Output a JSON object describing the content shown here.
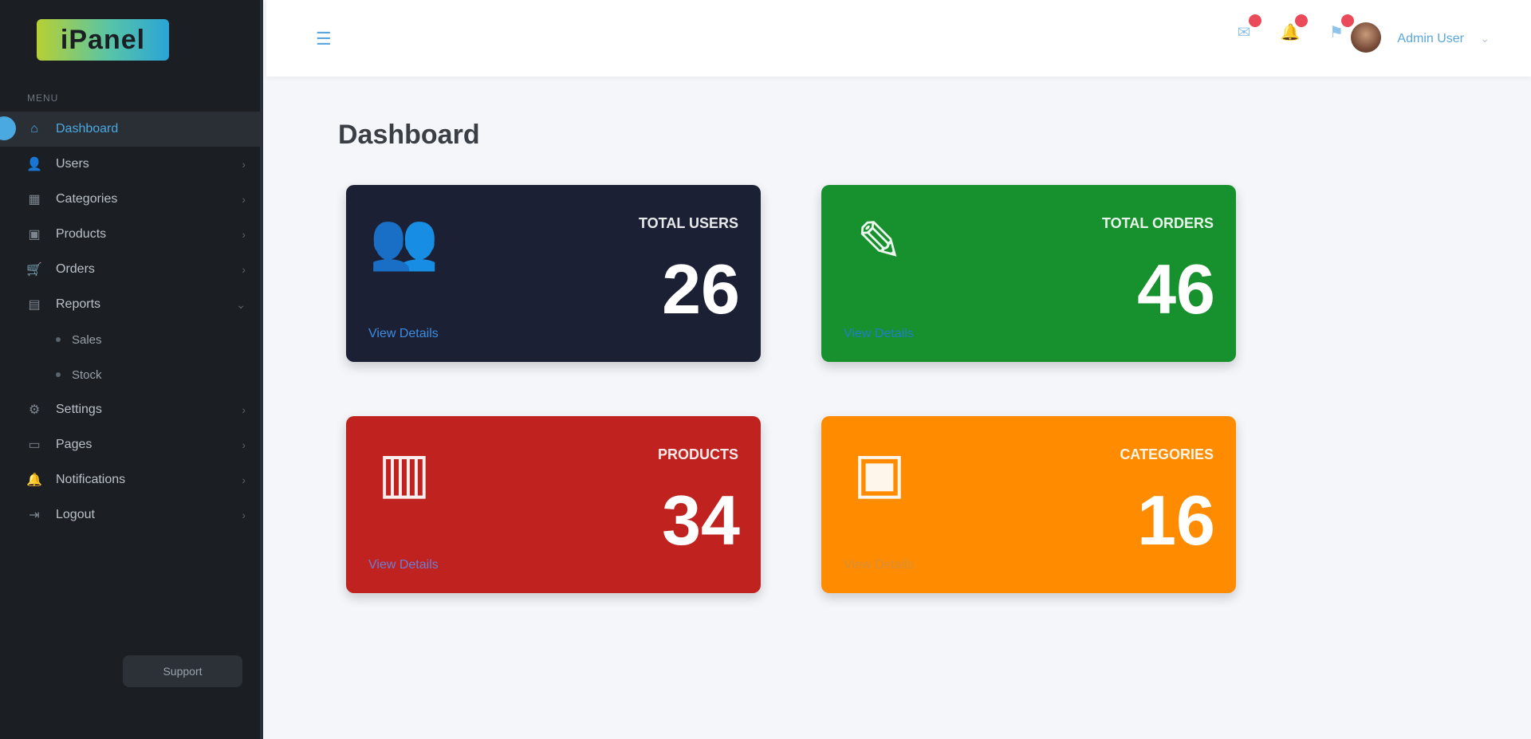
{
  "app": {
    "logo_text": "iPanel"
  },
  "sidebar": {
    "section_label": "MENU",
    "items": [
      {
        "label": "Dashboard",
        "icon": "home-icon",
        "glyph": "⌂",
        "active": true
      },
      {
        "label": "Users",
        "icon": "users-icon",
        "glyph": "👤"
      },
      {
        "label": "Categories",
        "icon": "folder-icon",
        "glyph": "▦"
      },
      {
        "label": "Products",
        "icon": "box-icon",
        "glyph": "▣"
      },
      {
        "label": "Orders",
        "icon": "cart-icon",
        "glyph": "🛒"
      },
      {
        "label": "Reports",
        "icon": "chart-icon",
        "glyph": "▤"
      },
      {
        "label": "Sales",
        "sub": true
      },
      {
        "label": "Stock",
        "sub": true
      },
      {
        "label": "Settings",
        "icon": "gear-icon",
        "glyph": "⚙"
      },
      {
        "label": "Pages",
        "icon": "file-icon",
        "glyph": "▭"
      },
      {
        "label": "Notifications",
        "icon": "bell-icon",
        "glyph": "🔔"
      },
      {
        "label": "Logout",
        "icon": "logout-icon",
        "glyph": "⇥"
      }
    ],
    "footer_button": "Support"
  },
  "topbar": {
    "menu_icon": "hamburger-icon",
    "icons": [
      {
        "name": "mail-icon",
        "glyph": "✉"
      },
      {
        "name": "bell-icon",
        "glyph": "🔔"
      },
      {
        "name": "flag-icon",
        "glyph": "⚑"
      }
    ],
    "username": "Admin User"
  },
  "page": {
    "title": "Dashboard"
  },
  "cards": [
    {
      "label": "TOTAL USERS",
      "value": "26",
      "link": "View Details",
      "icon": "users-icon",
      "glyph": "👥",
      "color": "#1c2034"
    },
    {
      "label": "TOTAL ORDERS",
      "value": "46",
      "link": "View Details",
      "icon": "pencil-icon",
      "glyph": "✎",
      "color": "#17902e"
    },
    {
      "label": "PRODUCTS",
      "value": "34",
      "link": "View Details",
      "icon": "chart-icon",
      "glyph": "▥",
      "color": "#c0221f"
    },
    {
      "label": "CATEGORIES",
      "value": "16",
      "link": "View Details",
      "icon": "box-icon",
      "glyph": "▣",
      "color": "#ff8c00"
    }
  ]
}
